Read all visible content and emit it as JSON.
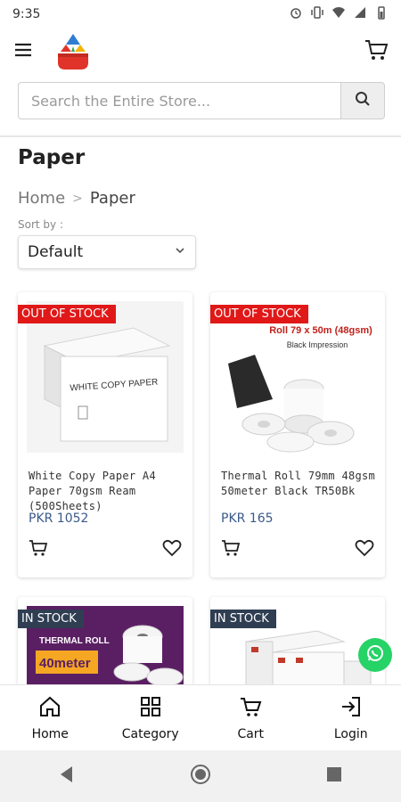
{
  "status_bar": {
    "time": "9:35"
  },
  "search": {
    "placeholder": "Search the Entire Store..."
  },
  "page": {
    "title": "Paper"
  },
  "breadcrumb": {
    "home": "Home",
    "separator": ">",
    "current": "Paper"
  },
  "sort": {
    "label": "Sort by :",
    "selected": "Default"
  },
  "products": [
    {
      "name": "White Copy Paper A4 Paper 70gsm Ream (500Sheets)",
      "price": "PKR 1052",
      "badge": "OUT OF STOCK",
      "image_text": "WHITE COPY PAPER"
    },
    {
      "name": "Thermal Roll 79mm 48gsm 50meter Black TR50Bk",
      "price": "PKR 165",
      "badge": "OUT OF STOCK",
      "image_text_1": "Roll 79 x 50m (48gsm)",
      "image_text_2": "Black Impression"
    },
    {
      "badge": "IN STOCK",
      "image_text_1": "THERMAL ROLL",
      "image_text_2": "40meter"
    },
    {
      "badge": "IN STOCK"
    }
  ],
  "bottom_nav": [
    {
      "label": "Home",
      "icon": "home-icon"
    },
    {
      "label": "Category",
      "icon": "grid-icon"
    },
    {
      "label": "Cart",
      "icon": "cart-icon"
    },
    {
      "label": "Login",
      "icon": "login-icon"
    }
  ],
  "colors": {
    "out_of_stock": "#e01818",
    "in_stock": "#2f3e52",
    "price": "#3a5a8a",
    "whatsapp": "#25d366"
  }
}
